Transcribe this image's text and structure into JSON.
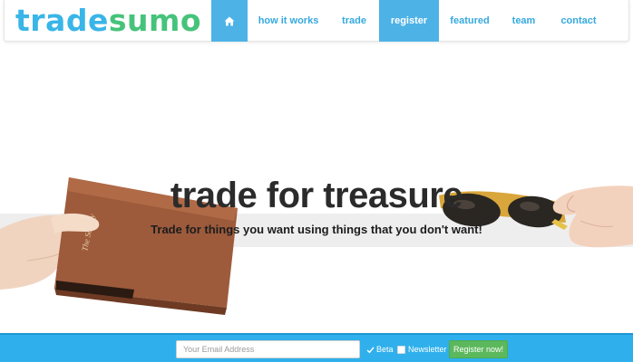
{
  "logo": {
    "part1": "trade",
    "part2": "sumo",
    "colors": {
      "trade": "#39b5e8",
      "sumo": "#46c37b"
    }
  },
  "nav": {
    "home_icon": "home-icon",
    "items": [
      {
        "label": "how it works"
      },
      {
        "label": "trade"
      },
      {
        "label": "register",
        "active": true
      },
      {
        "label": "featured"
      },
      {
        "label": "team"
      },
      {
        "label": "contact"
      }
    ],
    "accent_color": "#4db2e6"
  },
  "hero": {
    "title": "trade for treasure",
    "subtitle": "Trade for things you want using things that you don't want!"
  },
  "signup": {
    "email_placeholder": "Your Email Address",
    "email_value": "",
    "beta_label": "Beta",
    "beta_checked": true,
    "newsletter_label": "Newsletter",
    "newsletter_checked": false,
    "register_label": "Register now!",
    "bar_color": "#2fb0ec",
    "button_color": "#5cb85c"
  }
}
